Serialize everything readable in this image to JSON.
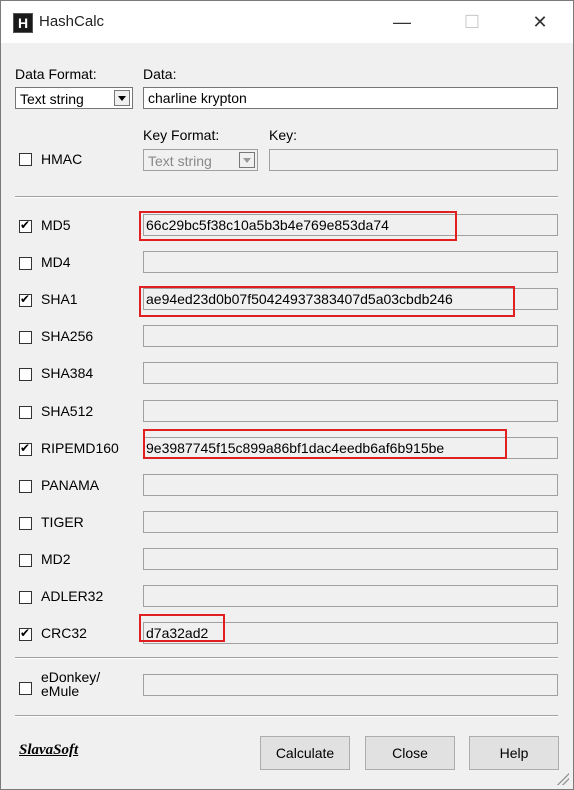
{
  "window": {
    "title": "HashCalc",
    "icon_letter": "H",
    "minimize_glyph": "—",
    "maximize_glyph": "☐",
    "close_glyph": "✕"
  },
  "input": {
    "data_format_label": "Data Format:",
    "data_format_value": "Text string",
    "data_label": "Data:",
    "data_value": "charline krypton"
  },
  "hmac": {
    "label": "HMAC",
    "checked": false,
    "key_format_label": "Key Format:",
    "key_format_value": "Text string",
    "key_label": "Key:",
    "key_value": ""
  },
  "hashes": [
    {
      "name": "MD5",
      "checked": true,
      "value": "66c29bc5f38c10a5b3b4e769e853da74"
    },
    {
      "name": "MD4",
      "checked": false,
      "value": ""
    },
    {
      "name": "SHA1",
      "checked": true,
      "value": "ae94ed23d0b07f50424937383407d5a03cbdb246"
    },
    {
      "name": "SHA256",
      "checked": false,
      "value": ""
    },
    {
      "name": "SHA384",
      "checked": false,
      "value": ""
    },
    {
      "name": "SHA512",
      "checked": false,
      "value": ""
    },
    {
      "name": "RIPEMD160",
      "checked": true,
      "value": "9e3987745f15c899a86bf1dac4eedb6af6b915be"
    },
    {
      "name": "PANAMA",
      "checked": false,
      "value": ""
    },
    {
      "name": "TIGER",
      "checked": false,
      "value": ""
    },
    {
      "name": "MD2",
      "checked": false,
      "value": ""
    },
    {
      "name": "ADLER32",
      "checked": false,
      "value": ""
    },
    {
      "name": "CRC32",
      "checked": true,
      "value": "d7a32ad2"
    }
  ],
  "edonkey": {
    "label_line1": "eDonkey/",
    "label_line2": "eMule",
    "checked": false,
    "value": ""
  },
  "footer": {
    "logo": "SlavaSoft",
    "calculate_label": "Calculate",
    "close_label": "Close",
    "help_label": "Help"
  },
  "colors": {
    "highlight": "#e02020",
    "window_bg": "#f0f0f0"
  }
}
